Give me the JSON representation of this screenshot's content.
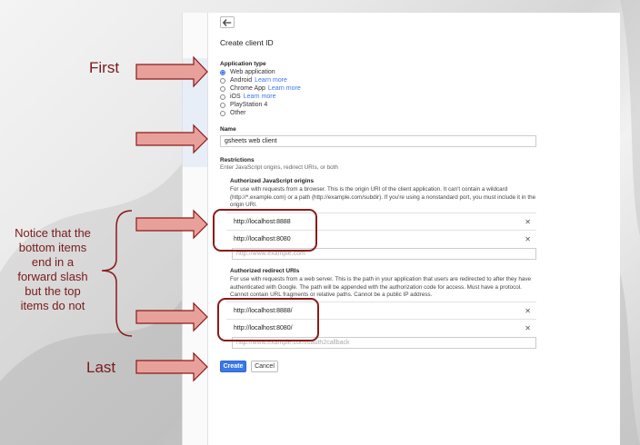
{
  "annotations": {
    "first": "First",
    "last": "Last",
    "notice_lines": [
      "Notice that the",
      "bottom items",
      "end in a",
      "forward slash",
      "but the top",
      "items do not"
    ]
  },
  "form": {
    "title": "Create client ID",
    "app_type_label": "Application type",
    "app_types": [
      {
        "label": "Web application",
        "link": ""
      },
      {
        "label": "Android",
        "link": "Learn more"
      },
      {
        "label": "Chrome App",
        "link": "Learn more"
      },
      {
        "label": "iOS",
        "link": "Learn more"
      },
      {
        "label": "PlayStation 4",
        "link": ""
      },
      {
        "label": "Other",
        "link": ""
      }
    ],
    "selected_app_type": "Web application",
    "name_label": "Name",
    "name_value": "gsheets web client",
    "restrictions_label": "Restrictions",
    "restrictions_help": "Enter JavaScript origins, redirect URIs, or both",
    "origins": {
      "label": "Authorized JavaScript origins",
      "help": "For use with requests from a browser. This is the origin URI of the client application. It can't contain a wildcard (http://*.example.com) or a path (http://example.com/subdir). If you're using a nonstandard port, you must include it in the origin URI.",
      "items": [
        "http://localhost:8888",
        "http://localhost:8080"
      ],
      "placeholder": "http://www.example.com"
    },
    "redirects": {
      "label": "Authorized redirect URIs",
      "help": "For use with requests from a web server. This is the path in your application that users are redirected to after they have authenticated with Google. The path will be appended with the authorization code for access. Must have a protocol. Cannot contain URL fragments or relative paths. Cannot be a public IP address.",
      "items": [
        "http://localhost:8888/",
        "http://localhost:8080/"
      ],
      "placeholder": "http://www.example.com/oauth2callback"
    },
    "create_label": "Create",
    "cancel_label": "Cancel"
  },
  "colors": {
    "accent": "#3b78e7",
    "annotation": "#8b1a1a"
  },
  "icons": {
    "back": "arrow-left-icon",
    "remove": "close-icon"
  }
}
